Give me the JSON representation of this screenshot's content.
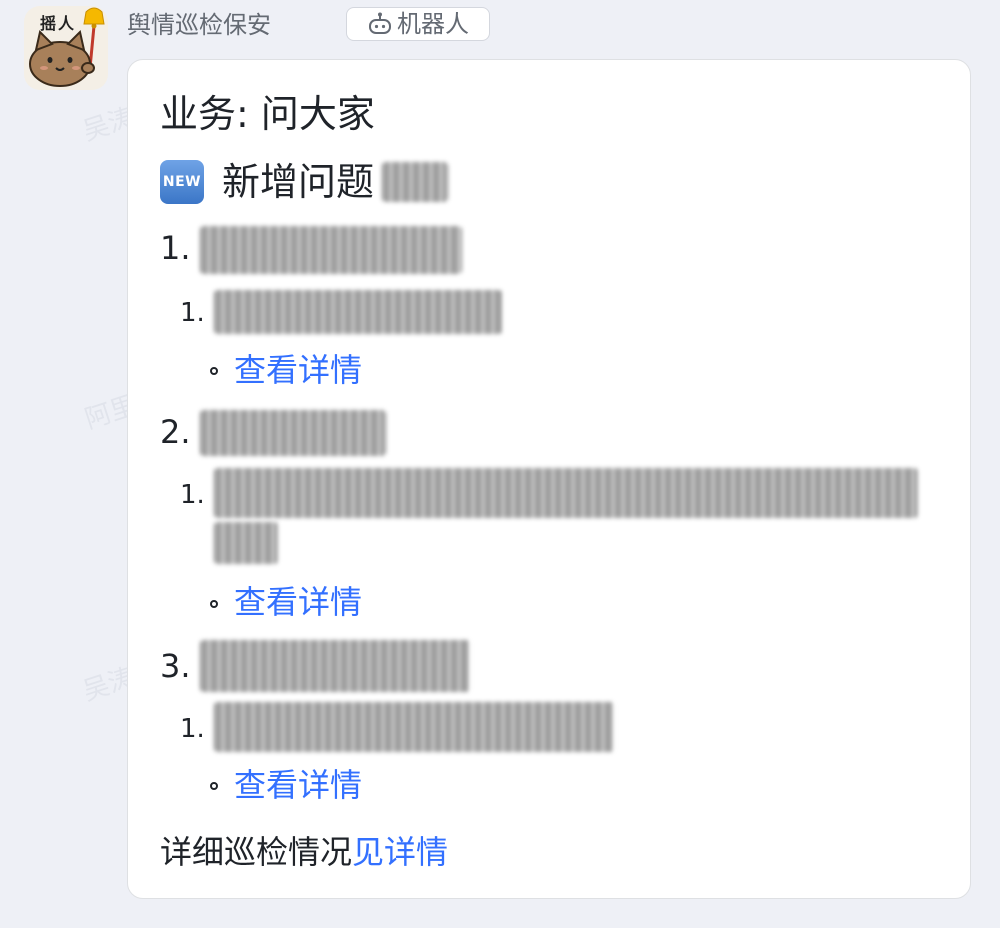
{
  "sender": {
    "name": "舆情巡检保安",
    "avatar_text": "摇人",
    "bot_badge": "机器人"
  },
  "watermark": {
    "lines": [
      "吴涛",
      "阿里",
      "吴涛"
    ]
  },
  "card": {
    "business_title": "业务: 问大家",
    "new_section_badge": "NEW",
    "new_section_heading": "新增问题",
    "issues": [
      {
        "number": "1.",
        "sub_items": [
          {
            "number": "1.",
            "link_label": "查看详情"
          }
        ]
      },
      {
        "number": "2.",
        "sub_items": [
          {
            "number": "1.",
            "link_label": "查看详情"
          }
        ]
      },
      {
        "number": "3.",
        "sub_items": [
          {
            "number": "1.",
            "link_label": "查看详情"
          }
        ]
      }
    ],
    "footer_text": "详细巡检情况",
    "footer_link": "见详情"
  },
  "colors": {
    "background": "#eef0f6",
    "card_background": "#ffffff",
    "link": "#3370ff",
    "text": "#1f2329",
    "muted": "#646a73"
  }
}
